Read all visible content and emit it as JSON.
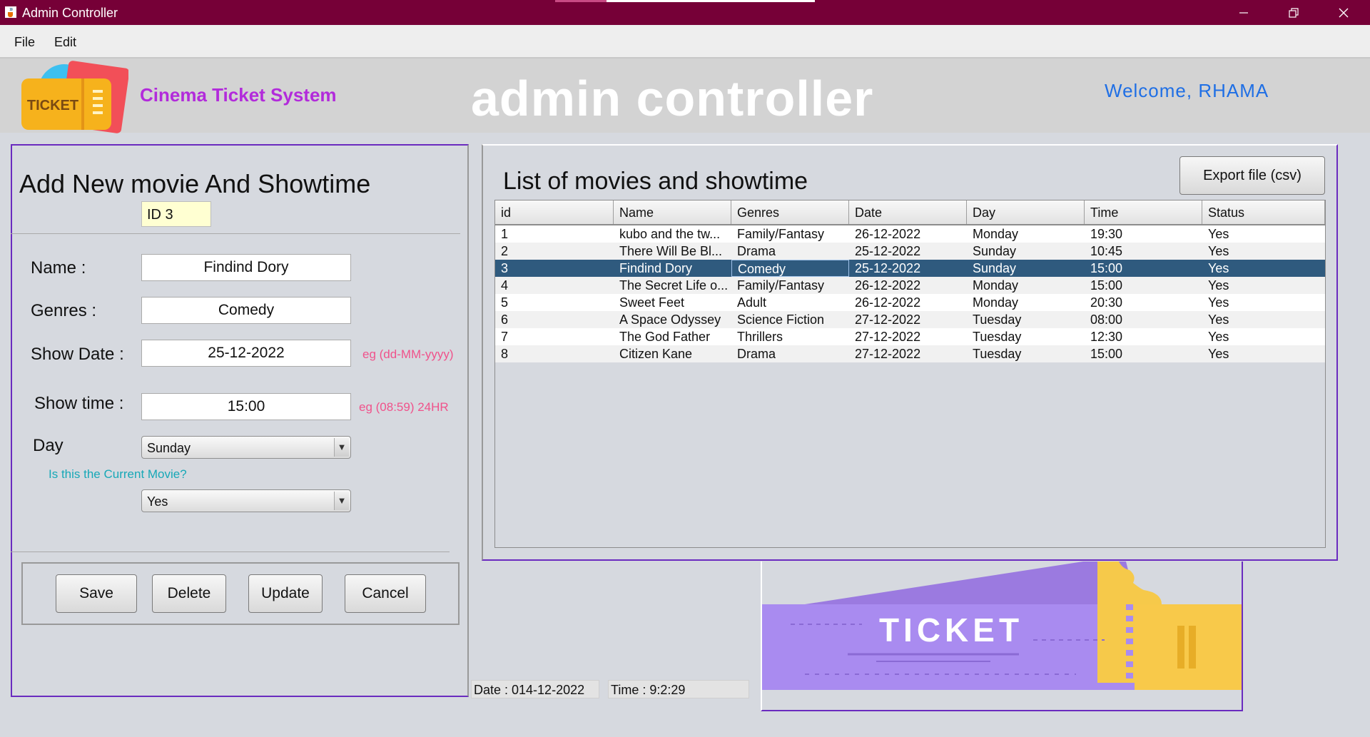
{
  "window": {
    "title": "Admin Controller",
    "icons": {
      "app": "java-cup-icon",
      "minimize": "minimize-icon",
      "maximize": "restore-icon",
      "close": "close-icon"
    }
  },
  "menu": {
    "file": "File",
    "edit": "Edit"
  },
  "header": {
    "system_name": "Cinema Ticket System",
    "title": "admin controller",
    "welcome": "Welcome,  RHAMA",
    "logo_text": "TICKET"
  },
  "form": {
    "title": "Add New movie And Showtime",
    "id_value": "ID  3",
    "name_label": "Name :",
    "name_value": "Findind Dory",
    "genres_label": "Genres :",
    "genres_value": "Comedy",
    "date_label": "Show Date :",
    "date_value": "25-12-2022",
    "date_hint": "eg (dd-MM-yyyy)",
    "time_label": "Show time :",
    "time_value": "15:00",
    "time_hint": "eg (08:59) 24HR",
    "day_label": "Day",
    "day_value": "Sunday",
    "current_question": "Is this the Current Movie?",
    "current_value": "Yes"
  },
  "buttons": {
    "save": "Save",
    "delete": "Delete",
    "update": "Update",
    "cancel": "Cancel",
    "export": "Export file (csv)"
  },
  "list": {
    "title": "List of movies and showtime",
    "columns": [
      "id",
      "Name",
      "Genres",
      "Date",
      "Day",
      "Time",
      "Status"
    ],
    "selected_row_index": 2,
    "rows": [
      [
        "1",
        "kubo and the tw...",
        "Family/Fantasy",
        "26-12-2022",
        "Monday",
        "19:30",
        "Yes"
      ],
      [
        "2",
        "There Will Be Bl...",
        "Drama",
        "25-12-2022",
        "Sunday",
        "10:45",
        "Yes"
      ],
      [
        "3",
        "Findind Dory",
        "Comedy",
        "25-12-2022",
        "Sunday",
        "15:00",
        "Yes"
      ],
      [
        "4",
        "The Secret Life o...",
        "Family/Fantasy",
        "26-12-2022",
        "Monday",
        "15:00",
        "Yes"
      ],
      [
        "5",
        "Sweet Feet",
        "Adult",
        "26-12-2022",
        "Monday",
        "20:30",
        "Yes"
      ],
      [
        "6",
        "A Space Odyssey",
        "Science Fiction",
        "27-12-2022",
        "Tuesday",
        "08:00",
        "Yes"
      ],
      [
        "7",
        "The God Father",
        "Thrillers",
        "27-12-2022",
        "Tuesday",
        "12:30",
        "Yes"
      ],
      [
        "8",
        "Citizen Kane",
        "Drama",
        "27-12-2022",
        "Tuesday",
        "15:00",
        "Yes"
      ]
    ]
  },
  "status": {
    "date": "Date : 014-12-2022",
    "time": "Time : 9:2:29"
  },
  "banner": {
    "text": "TICKET"
  },
  "colors": {
    "titlebar": "#760037",
    "accent": "#b22bdb",
    "welcome": "#1f6fe5",
    "selection": "#2f5a7e",
    "panel_border": "#6a2bbf"
  }
}
